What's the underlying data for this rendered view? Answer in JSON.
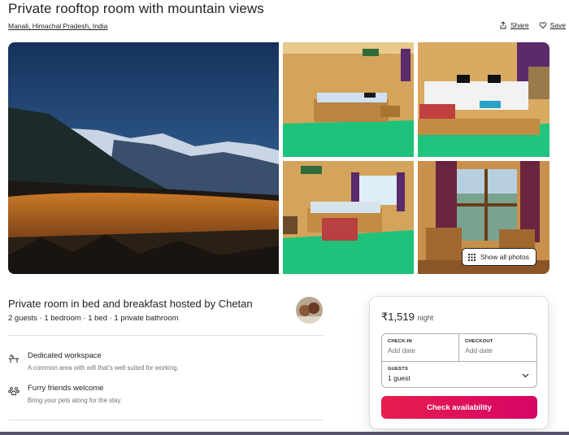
{
  "listing": {
    "title": "Private rooftop room with mountain views",
    "location": "Manali, Himachal Pradesh, India",
    "share_label": "Share",
    "save_label": "Save"
  },
  "gallery": {
    "show_all_label": "Show all photos",
    "photos": [
      {
        "icon": "valley-night-photo"
      },
      {
        "icon": "wooden-room-photo"
      },
      {
        "icon": "bed-photo"
      },
      {
        "icon": "room-window-photo"
      },
      {
        "icon": "balcony-photo"
      }
    ]
  },
  "host": {
    "title": "Private room in bed and breakfast hosted by Chetan",
    "summary": "2 guests · 1 bedroom · 1 bed · 1 private bathroom"
  },
  "features": [
    {
      "icon": "workspace-icon",
      "title": "Dedicated workspace",
      "desc": "A common area with wifi that’s well suited for working."
    },
    {
      "icon": "paw-icon",
      "title": "Furry friends welcome",
      "desc": "Bring your pets along for the stay."
    }
  ],
  "booking": {
    "price": "₹1,519",
    "unit": "night",
    "checkin_label": "CHECK-IN",
    "checkin_value": "Add date",
    "checkout_label": "CHECKOUT",
    "checkout_value": "Add date",
    "guests_label": "GUESTS",
    "guests_value": "1 guest",
    "cta_label": "Check availability"
  },
  "colors": {
    "accent_start": "#e61e4d",
    "accent_end": "#d70466",
    "text": "#222222",
    "muted": "#717171"
  }
}
